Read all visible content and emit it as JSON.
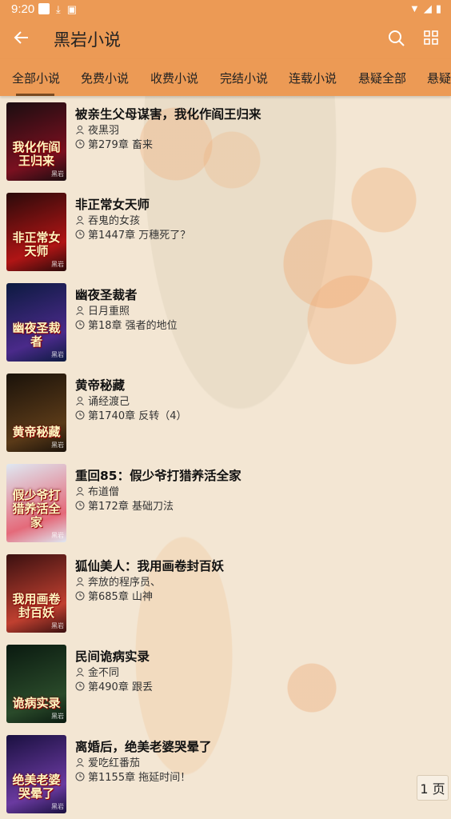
{
  "status": {
    "time": "9:20",
    "icons": [
      "notification-square-icon",
      "download-icon",
      "app-icon",
      "wifi-icon",
      "signal-icon",
      "battery-icon"
    ]
  },
  "header": {
    "title": "黑岩小说",
    "back_icon": "arrow-left-icon",
    "search_icon": "search-icon",
    "grid_icon": "grid-icon"
  },
  "tabs": [
    {
      "label": "全部小说",
      "active": true
    },
    {
      "label": "免费小说"
    },
    {
      "label": "收费小说"
    },
    {
      "label": "完结小说"
    },
    {
      "label": "连载小说"
    },
    {
      "label": "悬疑全部"
    },
    {
      "label": "悬疑完"
    }
  ],
  "books": [
    {
      "title": "被亲生父母谋害，我化作阎王归来",
      "author": "夜黑羽",
      "chapter": "第279章 畜来",
      "cover_text": "我化作阎王归来",
      "cover_colors": [
        "#1a0d10",
        "#7a1020"
      ]
    },
    {
      "title": "非正常女天师",
      "author": "吞鬼的女孩",
      "chapter": "第1447章 万穗死了？",
      "cover_text": "非正常女天师",
      "cover_colors": [
        "#2a0a0a",
        "#b01515"
      ]
    },
    {
      "title": "幽夜圣裁者",
      "author": "日月重照",
      "chapter": "第18章 强者的地位",
      "cover_text": "幽夜圣裁者",
      "cover_colors": [
        "#0c1a40",
        "#4a2a8a"
      ]
    },
    {
      "title": "黄帝秘藏",
      "author": "诵经渡己",
      "chapter": "第1740章 反转（4）",
      "cover_text": "黄帝秘藏",
      "cover_colors": [
        "#1a120a",
        "#5a3a18"
      ]
    },
    {
      "title": "重回85：假少爷打猎养活全家",
      "author": "布道僧",
      "chapter": "第172章 基础刀法",
      "cover_text": "假少爷打猎养活全家",
      "cover_colors": [
        "#dfe8f2",
        "#e46a7a"
      ]
    },
    {
      "title": "狐仙美人：我用画卷封百妖",
      "author": "奔放的程序员、",
      "chapter": "第685章 山神",
      "cover_text": "我用画卷封百妖",
      "cover_colors": [
        "#3a1010",
        "#c04030"
      ]
    },
    {
      "title": "民间诡病实录",
      "author": "金不同",
      "chapter": "第490章 跟丢",
      "cover_text": "诡病实录",
      "cover_colors": [
        "#0a1a10",
        "#2a4a2a"
      ]
    },
    {
      "title": "离婚后，绝美老婆哭晕了",
      "author": "爱吃红番茄",
      "chapter": "第1155章 拖延时间！",
      "cover_text": "绝美老婆哭晕了",
      "cover_colors": [
        "#1a1040",
        "#6a3aa0"
      ]
    }
  ],
  "pagination": {
    "label": "1 页"
  },
  "colors": {
    "accent": "#ec9a55",
    "background": "#f3e6d3",
    "tab_indicator": "#7a4a20"
  }
}
